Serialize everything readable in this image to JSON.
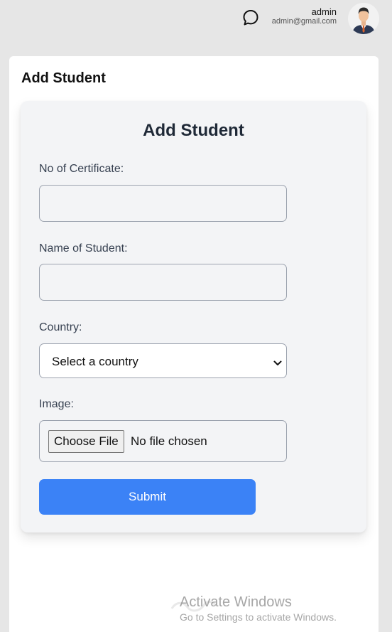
{
  "header": {
    "user_name": "admin",
    "user_email": "admin@gmail.com",
    "chat_icon": "chat-bubble-icon",
    "avatar_icon": "user-avatar-icon"
  },
  "panel": {
    "title": "Add Student"
  },
  "form": {
    "title": "Add Student",
    "certificate": {
      "label": "No of Certificate:",
      "value": ""
    },
    "student_name": {
      "label": "Name of Student:",
      "value": ""
    },
    "country": {
      "label": "Country:",
      "selected": "Select a country"
    },
    "image": {
      "label": "Image:",
      "button_label": "Choose File",
      "status": "No file chosen"
    },
    "submit_label": "Submit"
  },
  "watermark": {
    "title": "Activate Windows",
    "subtitle": "Go to Settings to activate Windows."
  },
  "colors": {
    "accent": "#3b82f6",
    "background": "#e6e6e6",
    "card": "#f3f4f6"
  }
}
